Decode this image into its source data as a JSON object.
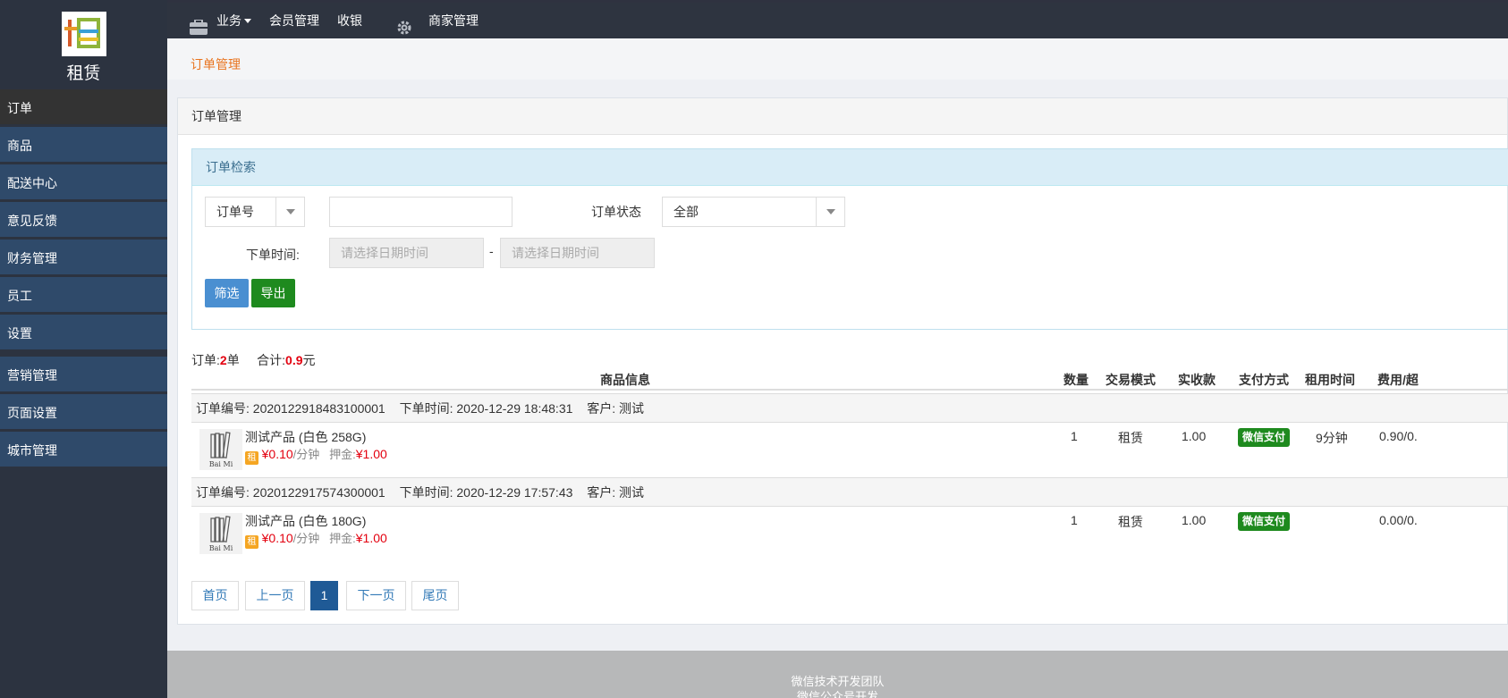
{
  "sidebar": {
    "logo_char": "租",
    "logo_text": "租赁",
    "items": [
      {
        "label": "订单"
      },
      {
        "label": "商品"
      },
      {
        "label": "配送中心"
      },
      {
        "label": "意见反馈"
      },
      {
        "label": "财务管理"
      },
      {
        "label": "员工"
      },
      {
        "label": "设置"
      },
      {
        "label": "营销管理"
      },
      {
        "label": "页面设置"
      },
      {
        "label": "城市管理"
      }
    ]
  },
  "topnav": {
    "business": "业务",
    "members": "会员管理",
    "cashier": "收银",
    "merchant": "商家管理"
  },
  "breadcrumb": "订单管理",
  "panel_title": "订单管理",
  "search": {
    "title": "订单检索",
    "field_select": "订单号",
    "order_no_value": "",
    "status_label": "订单状态",
    "status_value": "全部",
    "time_label": "下单时间:",
    "date_start_placeholder": "请选择日期时间",
    "date_sep": "-",
    "date_end_placeholder": "请选择日期时间",
    "filter_button": "筛选",
    "export_button": "导出"
  },
  "summary": {
    "orders_label": "订单:",
    "orders_count": "2",
    "orders_unit": "单",
    "total_label": "合计:",
    "total_value": "0.9",
    "total_unit": "元"
  },
  "table": {
    "headers": [
      "商品信息",
      "数量",
      "交易模式",
      "实收款",
      "支付方式",
      "租用时间",
      "费用/超"
    ]
  },
  "orders": [
    {
      "order_no": "订单编号: 2020122918483100001",
      "order_time": "下单时间: 2020-12-29 18:48:31",
      "customer": "客户: 测试",
      "product": "测试产品 (白色 258G)",
      "rent_tag": "租",
      "price": "¥0.10",
      "price_unit": "/分钟",
      "deposit_label": "押金:",
      "deposit": "¥1.00",
      "qty": "1",
      "mode": "租赁",
      "paid": "1.00",
      "pay_method": "微信支付",
      "duration": "9分钟",
      "fee": "0.90/0."
    },
    {
      "order_no": "订单编号: 2020122917574300001",
      "order_time": "下单时间: 2020-12-29 17:57:43",
      "customer": "客户: 测试",
      "product": "测试产品 (白色 180G)",
      "rent_tag": "租",
      "price": "¥0.10",
      "price_unit": "/分钟",
      "deposit_label": "押金:",
      "deposit": "¥1.00",
      "qty": "1",
      "mode": "租赁",
      "paid": "1.00",
      "pay_method": "微信支付",
      "duration": "",
      "fee": "0.00/0."
    }
  ],
  "pagination": {
    "first": "首页",
    "prev": "上一页",
    "current": "1",
    "next": "下一页",
    "last": "尾页"
  },
  "footer": {
    "line1": "微信技术开发团队",
    "line2": "微信公众号开发"
  },
  "colors": {
    "sidebar_bg": "#2c3340",
    "menu_item_bg": "#2f4a6a",
    "accent_orange": "#e8741f",
    "filter_btn": "#4a8fd1",
    "export_btn": "#1e8a1e",
    "pay_badge": "#1e8a1e",
    "price_red": "#e3000f"
  },
  "icons": [
    "briefcase-icon",
    "caret-down-icon",
    "gear-icon",
    "book-thumbnail-icon"
  ]
}
